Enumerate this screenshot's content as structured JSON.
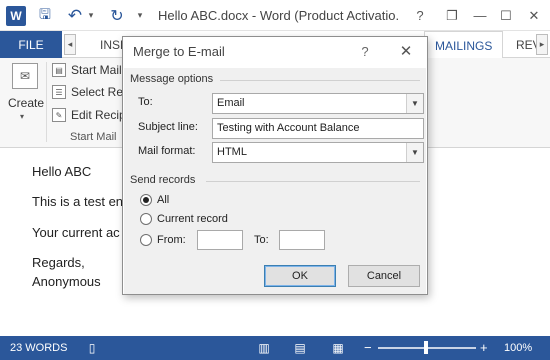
{
  "window": {
    "title": "Hello ABC.docx - Word (Product Activatio...",
    "logo_letter": "W",
    "buttons": {
      "help": "?",
      "restore": "❐",
      "minimize": "—",
      "maximize": "☐",
      "close": "✕"
    }
  },
  "quick_access": {
    "save": "🖫",
    "undo": "↶",
    "undo_menu": "▾",
    "redo": "↻",
    "more": "▾"
  },
  "tabs": {
    "file": "FILE",
    "insert_partial": "INSE",
    "mailings": "MAILINGS",
    "review_partial": "REV",
    "scroll_left": "◂",
    "scroll_right": "▸"
  },
  "ribbon": {
    "create_label": "Create",
    "create_dd": "▾",
    "start_mail_merge": "Start Mail",
    "select_recipients": "Select Reci",
    "edit_recipients": "Edit Recip",
    "group_label": "Start Mail"
  },
  "document": {
    "lines": [
      "Hello ABC",
      "This is a test en",
      "Your current ac",
      "Regards,",
      "Anonymous"
    ]
  },
  "statusbar": {
    "words": "23 WORDS",
    "zoom_minus": "−",
    "zoom_plus": "+",
    "zoom_pct": "100%",
    "zoom_level": 1.0
  },
  "dialog": {
    "title": "Merge to E-mail",
    "help": "?",
    "close": "✕",
    "message_options": {
      "section": "Message options",
      "to_label": "To:",
      "to_value": "Email",
      "subject_label": "Subject line:",
      "subject_value": "Testing with Account Balance",
      "format_label": "Mail format:",
      "format_value": "HTML"
    },
    "send_records": {
      "section": "Send records",
      "all": "All",
      "current": "Current record",
      "from": "From:",
      "to": "To:",
      "selected": "all"
    },
    "ok": "OK",
    "cancel": "Cancel"
  }
}
